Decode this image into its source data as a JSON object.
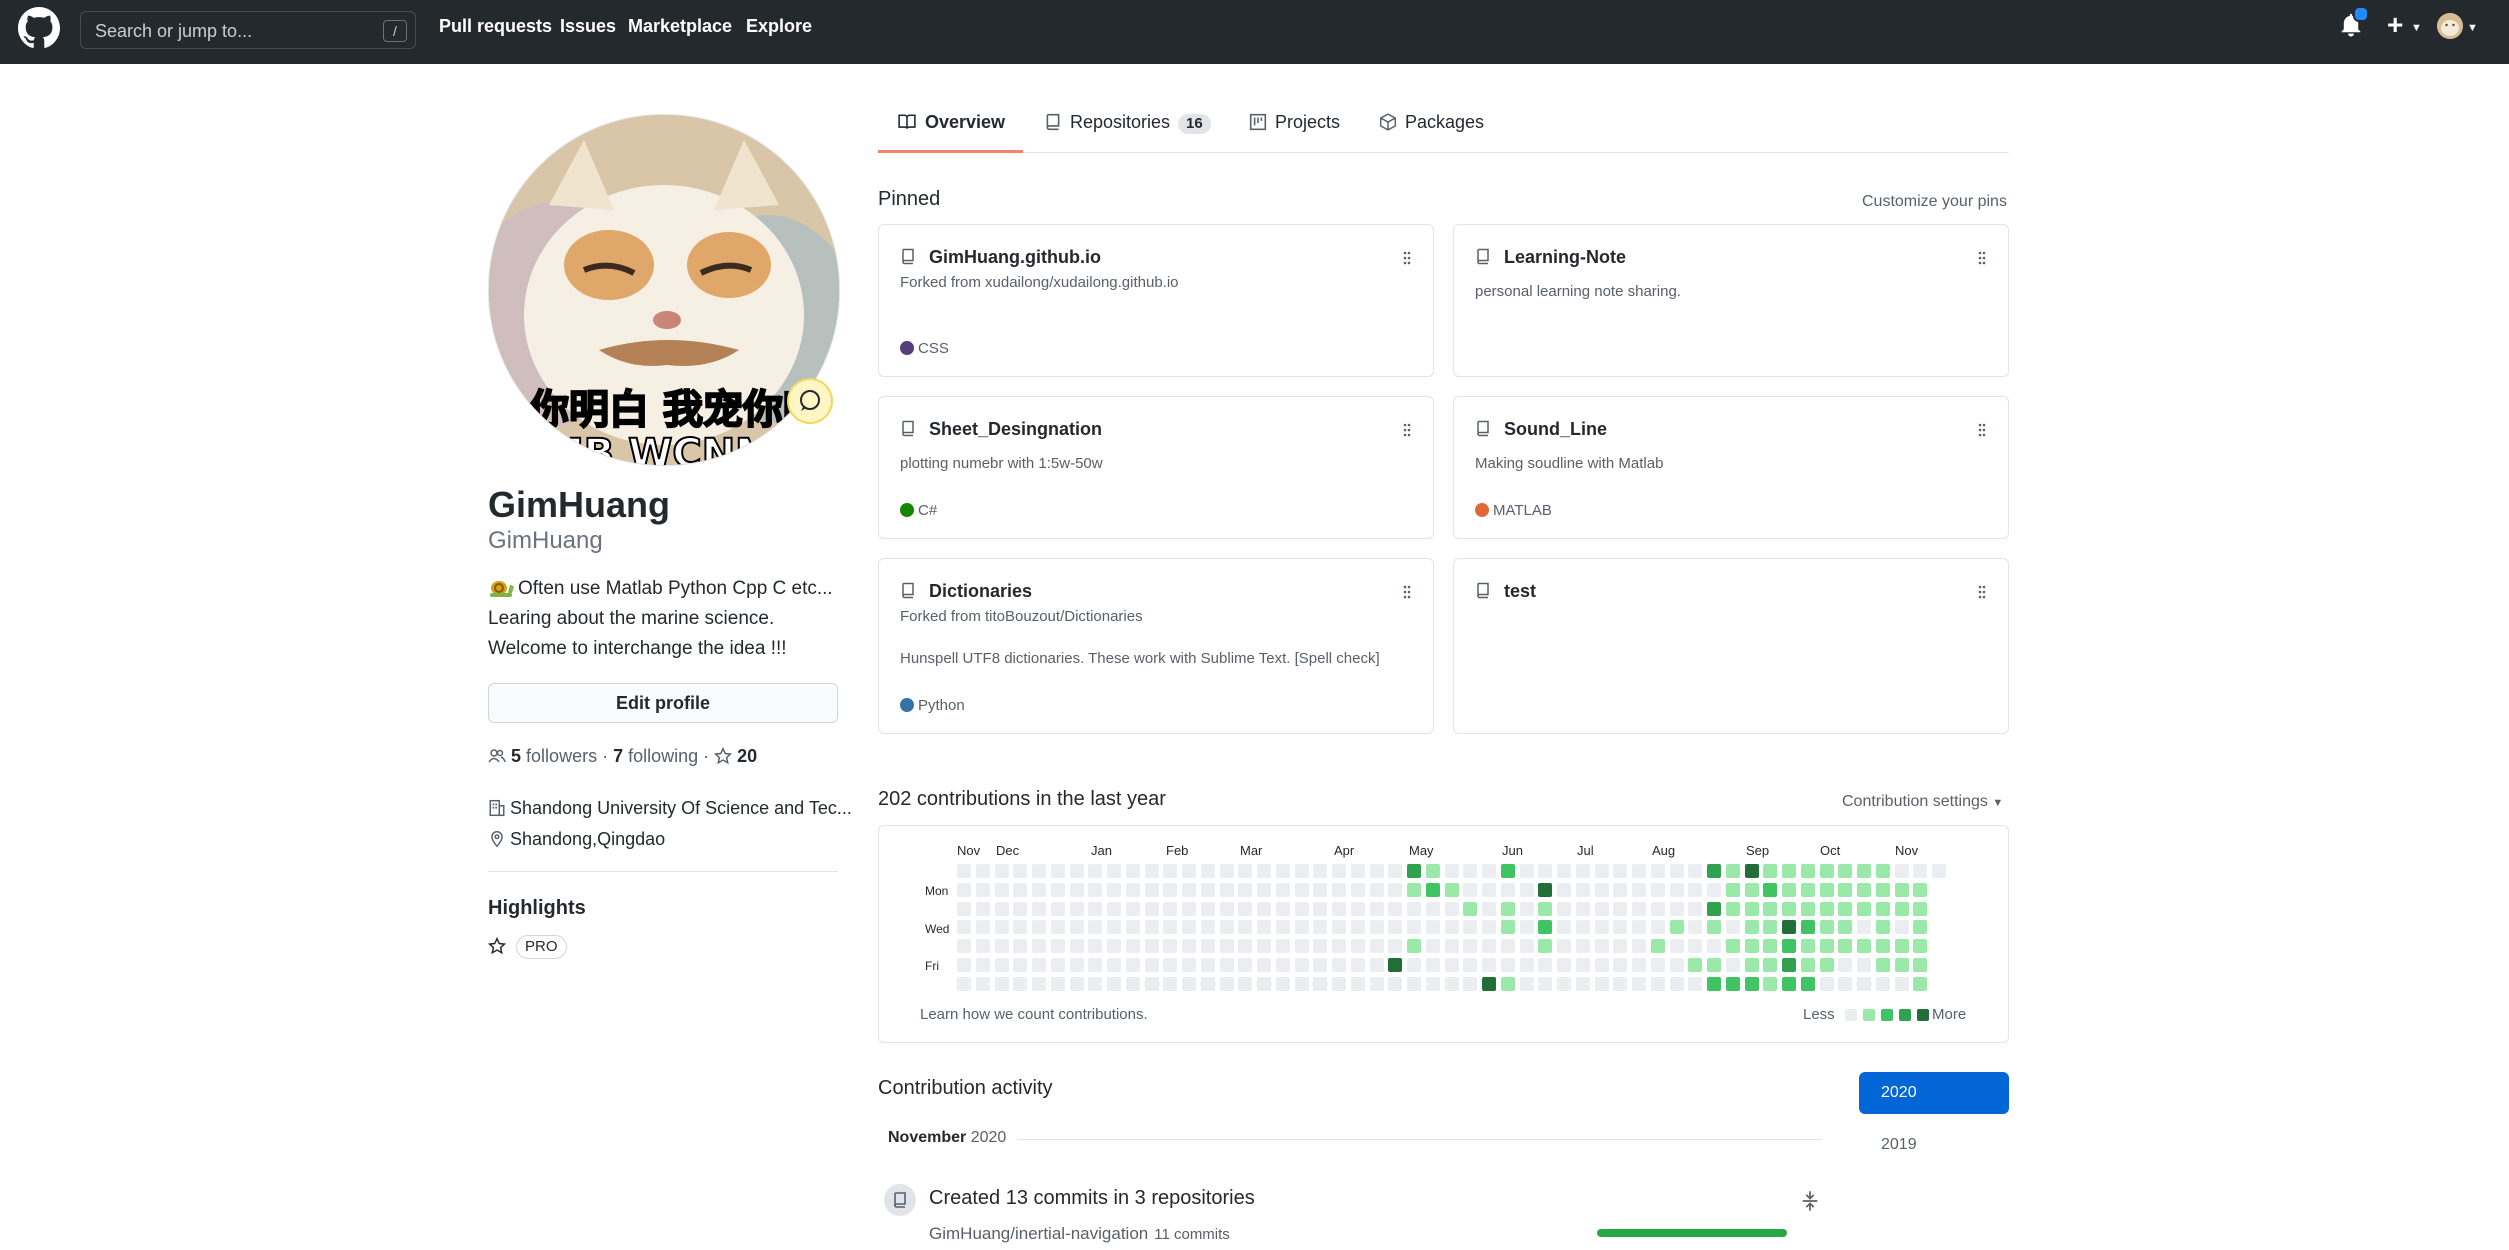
{
  "header": {
    "search_placeholder": "Search or jump to...",
    "search_shortcut": "/",
    "nav": [
      "Pull requests",
      "Issues",
      "Marketplace",
      "Explore"
    ],
    "plus": "+"
  },
  "profile": {
    "name": "GimHuang",
    "login": "GimHuang",
    "bio": "Often use Matlab Python Cpp C etc... Learing about the marine science. Welcome to interchange the idea !!!",
    "edit_label": "Edit profile",
    "followers_count": "5",
    "followers_label": "followers",
    "following_count": "7",
    "following_label": "following",
    "stars_count": "20",
    "organization": "Shandong University Of Science and Tec...",
    "location": "Shandong,Qingdao",
    "highlights_title": "Highlights",
    "pro_label": "PRO"
  },
  "tabs": [
    {
      "label": "Overview"
    },
    {
      "label": "Repositories",
      "count": "16"
    },
    {
      "label": "Projects"
    },
    {
      "label": "Packages"
    }
  ],
  "pinned": {
    "title": "Pinned",
    "customize_label": "Customize your pins",
    "items": [
      {
        "name": "GimHuang.github.io",
        "fork": "Forked from xudailong/xudailong.github.io",
        "desc": "",
        "lang": "CSS",
        "lang_color": "#563d7c"
      },
      {
        "name": "Learning-Note",
        "fork": "",
        "desc": "personal learning note sharing.",
        "lang": "",
        "lang_color": ""
      },
      {
        "name": "Sheet_Desingnation",
        "fork": "",
        "desc": "plotting numebr with 1:5w-50w",
        "lang": "C#",
        "lang_color": "#178600"
      },
      {
        "name": "Sound_Line",
        "fork": "",
        "desc": "Making soudline with Matlab",
        "lang": "MATLAB",
        "lang_color": "#e16737"
      },
      {
        "name": "Dictionaries",
        "fork": "Forked from titoBouzout/Dictionaries",
        "desc": "Hunspell UTF8 dictionaries. These work with Sublime Text. [Spell check]",
        "lang": "Python",
        "lang_color": "#3572A5"
      },
      {
        "name": "test",
        "fork": "",
        "desc": "",
        "lang": "",
        "lang_color": ""
      }
    ]
  },
  "contributions": {
    "title": "202 contributions in the last year",
    "settings_label": "Contribution settings",
    "months": [
      "Nov",
      "Dec",
      "Jan",
      "Feb",
      "Mar",
      "Apr",
      "May",
      "Jun",
      "Jul",
      "Aug",
      "Sep",
      "Oct",
      "Nov"
    ],
    "day_labels": [
      "Mon",
      "Wed",
      "Fri"
    ],
    "learn_label": "Learn how we count contributions.",
    "less_label": "Less",
    "more_label": "More",
    "palette": [
      "#ebedf0",
      "#9be9a8",
      "#40c463",
      "#30a14e",
      "#216e39"
    ]
  },
  "activity": {
    "title": "Contribution activity",
    "years": [
      "2020",
      "2019"
    ],
    "month_heading": "November",
    "month_year": "2020",
    "event_title": "Created 13 commits in 3 repositories",
    "event_repo": "GimHuang/inertial-navigation",
    "event_commits": "11 commits"
  }
}
